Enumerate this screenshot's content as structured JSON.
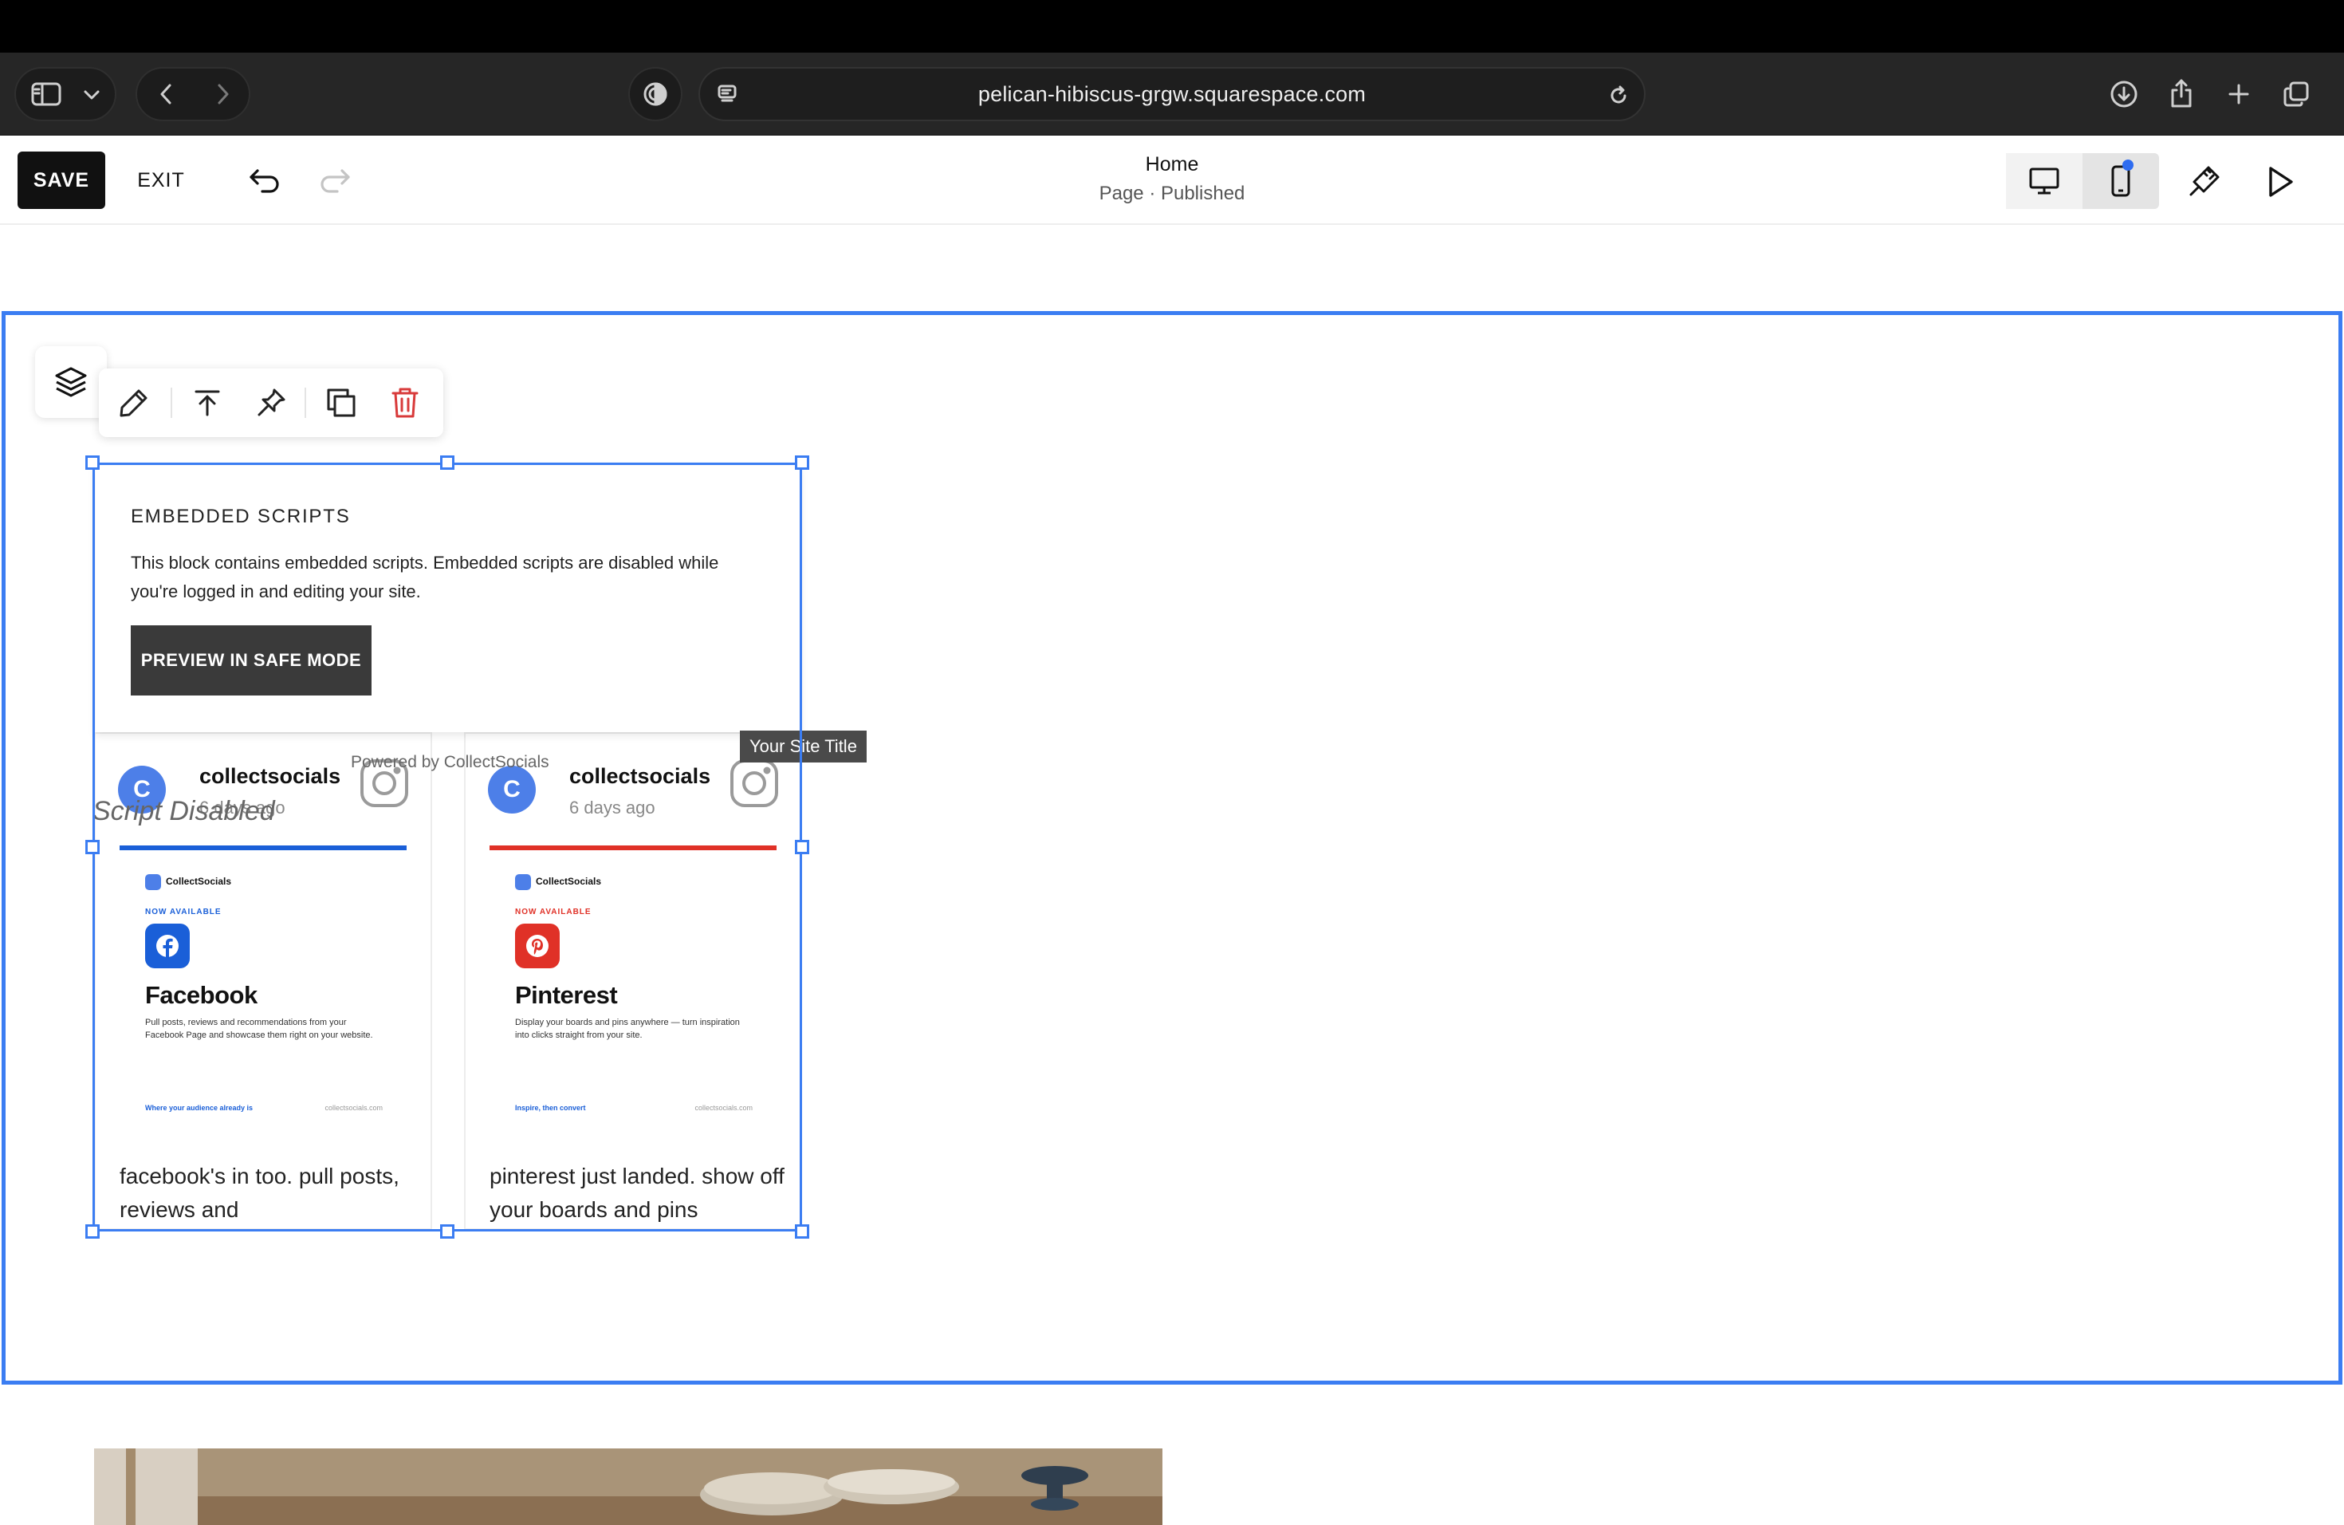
{
  "browser": {
    "url": "pelican-hibiscus-grgw.squarespace.com",
    "icons": [
      "sidebar-icon",
      "chevron-down-icon",
      "back-icon",
      "forward-icon",
      "privacy-shield-icon",
      "page-menu-icon",
      "reload-icon",
      "download-icon",
      "share-icon",
      "new-tab-icon",
      "tabs-overview-icon"
    ]
  },
  "editor": {
    "save_label": "SAVE",
    "exit_label": "EXIT",
    "page_title": "Home",
    "page_status": "Page · Published",
    "device_modes": [
      "desktop",
      "mobile"
    ]
  },
  "block_toolbar": {
    "icons": [
      "layers-icon",
      "pencil-icon",
      "move-to-top-icon",
      "pin-icon",
      "duplicate-icon",
      "trash-icon"
    ]
  },
  "embed_block": {
    "title": "EMBEDDED SCRIPTS",
    "text": "This block contains embedded scripts. Embedded scripts are disabled while you're logged in and editing your site.",
    "button_label": "PREVIEW IN SAFE MODE",
    "powered_by": "Powered by CollectSocials",
    "script_disabled": "Script Disabled",
    "tooltip": "Your Site Title"
  },
  "posts": [
    {
      "avatar_letter": "C",
      "account": "collectsocials",
      "time": "6 days ago",
      "promo": {
        "brand": "CollectSocials",
        "badge": "NOW AVAILABLE",
        "app_name": "Facebook",
        "description": "Pull posts, reviews and recommendations from your Facebook Page and showcase them right on your website.",
        "tagline": "Where your audience already is",
        "site": "collectsocials.com",
        "accent": "#1a5fd8"
      },
      "caption": "facebook's in too. pull posts, reviews and"
    },
    {
      "avatar_letter": "C",
      "account": "collectsocials",
      "time": "6 days ago",
      "promo": {
        "brand": "CollectSocials",
        "badge": "NOW AVAILABLE",
        "app_name": "Pinterest",
        "description": "Display your boards and pins anywhere — turn inspiration into clicks straight from your site.",
        "tagline": "Inspire, then convert",
        "site": "collectsocials.com",
        "accent": "#e03127"
      },
      "caption": "pinterest just landed. show off your boards and pins"
    }
  ],
  "colors": {
    "selection": "#3b7df2",
    "dark_button": "#3a3a3a",
    "avatar": "#4d7fe8",
    "trash": "#d83a3a",
    "notification_dot": "#2e6cf0"
  }
}
